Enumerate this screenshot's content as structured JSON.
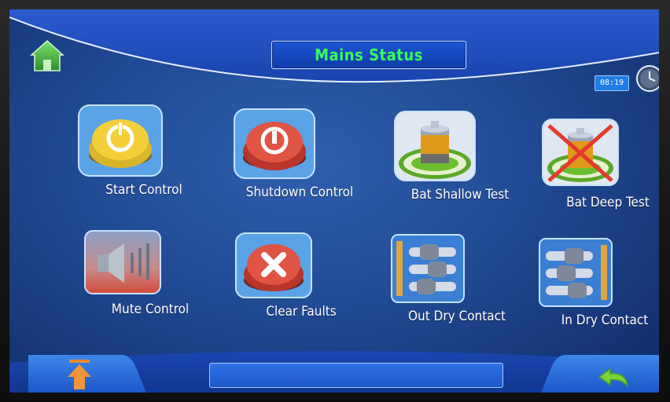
{
  "header": {
    "title": "Mains Status",
    "time": "08:19",
    "home_icon": "home-icon",
    "clock_icon": "clock-icon"
  },
  "tiles": [
    {
      "label": "Start Control",
      "icon": "power-on-button-icon"
    },
    {
      "label": "Shutdown Control",
      "icon": "power-off-button-icon"
    },
    {
      "label": "Bat Shallow Test",
      "icon": "battery-test-icon"
    },
    {
      "label": "Bat Deep Test",
      "icon": "battery-deep-test-disabled-icon"
    },
    {
      "label": "Mute Control",
      "icon": "speaker-mute-icon"
    },
    {
      "label": "Clear Faults",
      "icon": "clear-x-button-icon"
    },
    {
      "label": "Out Dry Contact",
      "icon": "output-dry-contact-icon"
    },
    {
      "label": "In Dry Contact",
      "icon": "input-dry-contact-icon"
    }
  ],
  "footer": {
    "status_text": "",
    "up_icon": "page-up-arrow-icon",
    "back_icon": "back-arrow-icon"
  },
  "colors": {
    "title_text": "#39ff5a",
    "screen_bg": "#214a94",
    "accent_blue": "#1f7de6"
  }
}
